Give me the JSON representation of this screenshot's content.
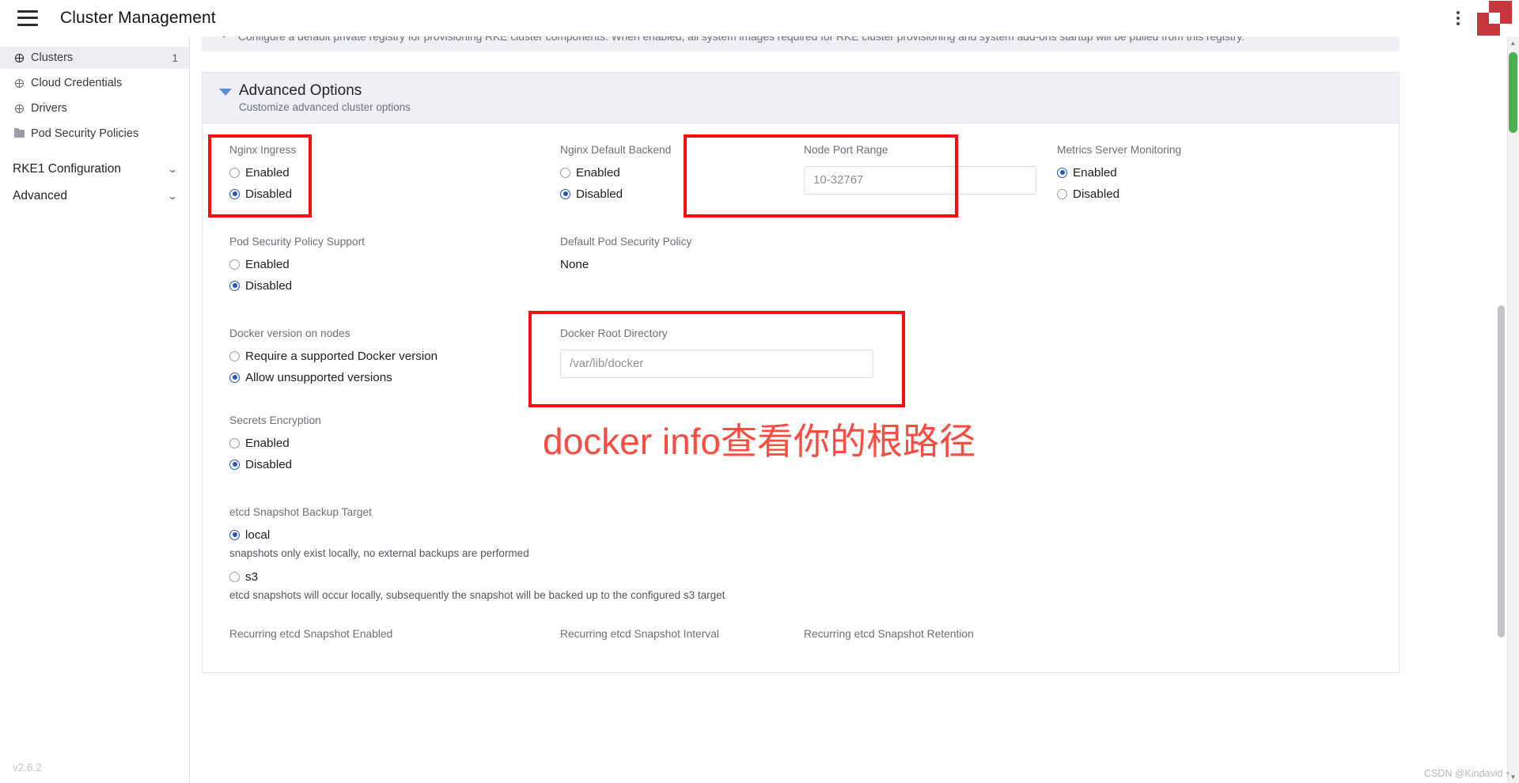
{
  "topbar": {
    "menu_icon": "hamburger-icon",
    "title": "Cluster Management",
    "kebab_icon": "more-vertical-icon",
    "logo": "rancher-logo"
  },
  "sidebar": {
    "items": [
      {
        "label": "Clusters",
        "icon": "globe-icon",
        "count": "1",
        "active": true
      },
      {
        "label": "Cloud Credentials",
        "icon": "globe-icon",
        "count": "",
        "active": false
      },
      {
        "label": "Drivers",
        "icon": "globe-icon",
        "count": "",
        "active": false
      },
      {
        "label": "Pod Security Policies",
        "icon": "folder-icon",
        "count": "",
        "active": false
      }
    ],
    "groups": [
      {
        "label": "RKE1 Configuration",
        "chevron": "chevron-down-icon"
      },
      {
        "label": "Advanced",
        "chevron": "chevron-down-icon"
      }
    ],
    "version": "v2.6.2"
  },
  "banner": {
    "text": "Configure a default private registry for provisioning RKE cluster components. When enabled, all system images required for RKE cluster provisioning and system add-ons startup will be pulled from this registry."
  },
  "advanced_panel": {
    "title": "Advanced Options",
    "subtitle": "Customize advanced cluster options",
    "caret": "caret-down-icon"
  },
  "fields": {
    "nginx_ingress": {
      "label": "Nginx Ingress",
      "options": [
        "Enabled",
        "Disabled"
      ],
      "selected": "Disabled"
    },
    "nginx_default_backend": {
      "label": "Nginx Default Backend",
      "options": [
        "Enabled",
        "Disabled"
      ],
      "selected": "Disabled"
    },
    "node_port_range": {
      "label": "Node Port Range",
      "value": "10-32767",
      "placeholder": "10-32767"
    },
    "metrics_server_monitoring": {
      "label": "Metrics Server Monitoring",
      "options": [
        "Enabled",
        "Disabled"
      ],
      "selected": "Enabled"
    },
    "pod_security_policy_support": {
      "label": "Pod Security Policy Support",
      "options": [
        "Enabled",
        "Disabled"
      ],
      "selected": "Disabled"
    },
    "default_pod_security_policy": {
      "label": "Default Pod Security Policy",
      "value": "None"
    },
    "docker_version_on_nodes": {
      "label": "Docker version on nodes",
      "options": [
        "Require a supported Docker version",
        "Allow unsupported versions"
      ],
      "selected": "Allow unsupported versions"
    },
    "docker_root_directory": {
      "label": "Docker Root Directory",
      "value": "/var/lib/docker",
      "placeholder": "/var/lib/docker"
    },
    "secrets_encryption": {
      "label": "Secrets Encryption",
      "options": [
        "Enabled",
        "Disabled"
      ],
      "selected": "Disabled"
    },
    "etcd_snapshot_backup_target": {
      "label": "etcd Snapshot Backup Target",
      "options": [
        {
          "label": "local",
          "help": "snapshots only exist locally, no external backups are performed"
        },
        {
          "label": "s3",
          "help": "etcd snapshots will occur locally, subsequently the snapshot will be backed up to the configured s3 target"
        }
      ],
      "selected": "local"
    },
    "recurring_etcd_snapshot_enabled": {
      "label": "Recurring etcd Snapshot Enabled"
    },
    "recurring_etcd_snapshot_interval": {
      "label": "Recurring etcd Snapshot Interval"
    },
    "recurring_etcd_snapshot_retention": {
      "label": "Recurring etcd Snapshot Retention"
    }
  },
  "annotations": {
    "chinese_note": "docker info查看你的根路径",
    "note_color": "#fe4b40",
    "box_color": "#fb0d0d",
    "boxes": [
      "nginx-ingress-box",
      "node-port-range-box",
      "docker-root-directory-box"
    ]
  },
  "watermark": {
    "text": "CSDN @Kindavid"
  }
}
